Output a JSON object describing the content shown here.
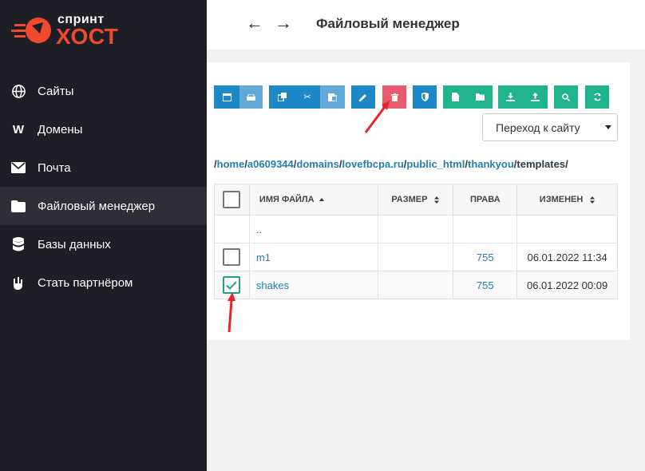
{
  "brand": {
    "line1": "спринт",
    "line2": "ХОСТ",
    "accent": "#f04a2d"
  },
  "sidebar": {
    "items": [
      {
        "label": "Сайты",
        "icon": "globe-icon"
      },
      {
        "label": "Домены",
        "icon": "w-icon"
      },
      {
        "label": "Почта",
        "icon": "mail-icon"
      },
      {
        "label": "Файловый менеджер",
        "icon": "folder-icon",
        "active": true
      },
      {
        "label": "Базы данных",
        "icon": "database-icon"
      },
      {
        "label": "Стать партнёром",
        "icon": "handshake-icon"
      }
    ]
  },
  "header": {
    "back": "←",
    "forward": "→",
    "title": "Файловый менеджер"
  },
  "toolbar": {
    "buttons": [
      {
        "name": "window-button",
        "icon": "window-icon"
      },
      {
        "name": "drive-button",
        "icon": "drive-icon"
      },
      {
        "name": "copy-button",
        "icon": "copy-icon"
      },
      {
        "name": "cut-button",
        "icon": "scissors-icon"
      },
      {
        "name": "paste-button",
        "icon": "paste-icon"
      },
      {
        "name": "rename-button",
        "icon": "pencil-icon"
      },
      {
        "name": "delete-button",
        "icon": "trash-icon"
      },
      {
        "name": "permissions-button",
        "icon": "shield-icon"
      },
      {
        "name": "new-file-button",
        "icon": "file-icon"
      },
      {
        "name": "new-folder-button",
        "icon": "folder-icon"
      },
      {
        "name": "download-button",
        "icon": "download-icon"
      },
      {
        "name": "upload-button",
        "icon": "upload-icon"
      },
      {
        "name": "search-button",
        "icon": "search-icon"
      },
      {
        "name": "refresh-button",
        "icon": "refresh-icon"
      }
    ],
    "goto_label": "Переход к сайту"
  },
  "path": {
    "root": "/",
    "parts": [
      "home",
      "a0609344",
      "domains",
      "lovefbcpa.ru",
      "public_html",
      "thankyou"
    ],
    "sep": "/",
    "current": "templates",
    "trailing": "/"
  },
  "table": {
    "headers": {
      "name": "ИМЯ ФАЙЛА",
      "size": "РАЗМЕР",
      "perms": "ПРАВА",
      "modified": "ИЗМЕНЕН"
    },
    "parent": "..",
    "rows": [
      {
        "name": "m1",
        "size": "",
        "perms": "755",
        "modified": "06.01.2022 11:34",
        "checked": false
      },
      {
        "name": "shakes",
        "size": "",
        "perms": "755",
        "modified": "06.01.2022 00:09",
        "checked": true
      }
    ]
  },
  "colors": {
    "sidebar": "#1e1f26",
    "primary": "#1e88c7",
    "green": "#1fb48c",
    "danger": "#ea5a6f",
    "annotation": "#e8232a"
  }
}
